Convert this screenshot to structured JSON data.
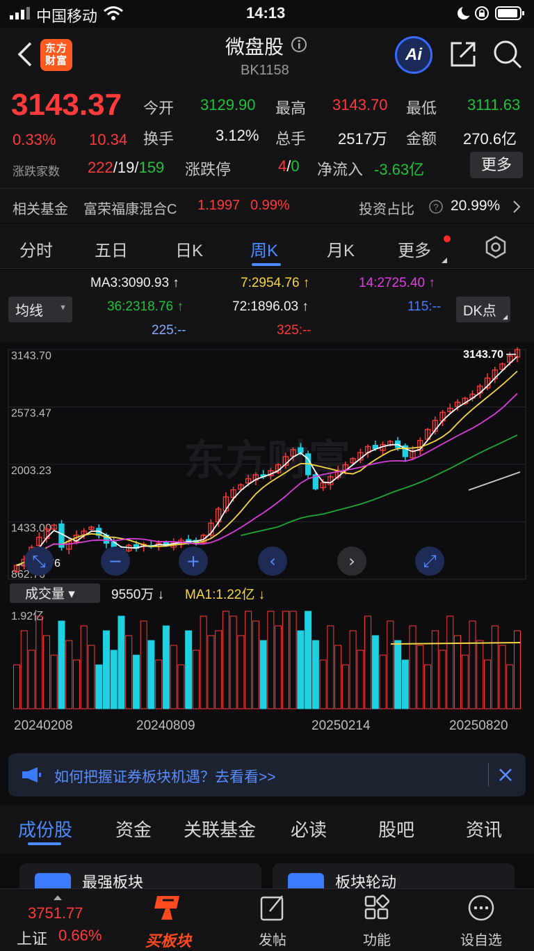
{
  "status_bar": {
    "carrier": "中国移动",
    "time": "14:13"
  },
  "header": {
    "title": "微盘股",
    "code": "BK1158",
    "logo_text": "东方财富",
    "ai_label": "Ai"
  },
  "quote": {
    "price": "3143.37",
    "change_pct": "0.33%",
    "change": "10.34",
    "open_label": "今开",
    "open": "3129.90",
    "high_label": "最高",
    "high": "3143.70",
    "low_label": "最低",
    "low": "3111.63",
    "turnover_label": "换手",
    "turnover": "3.12%",
    "volume_label": "总手",
    "volume": "2517万",
    "amount_label": "金额",
    "amount": "270.6亿",
    "breadth_label": "涨跌家数",
    "up": "222",
    "flat": "19",
    "down": "159",
    "limit_label": "涨跌停",
    "limit_up": "4",
    "limit_down": "0",
    "netflow_label": "净流入",
    "netflow": "-3.63亿",
    "more_button": "更多",
    "fund_label": "相关基金",
    "fund_name": "富荣福康混合C",
    "fund_nav": "1.1997",
    "fund_pct": "0.99%",
    "invest_label": "投资占比",
    "invest_pct": "20.99%"
  },
  "tabs": [
    "分时",
    "五日",
    "日K",
    "周K",
    "月K",
    "更多"
  ],
  "active_tab": "周K",
  "ma": {
    "ma_dropdown": "均线",
    "ma3": "MA3:3090.93",
    "ma7": "7:2954.76",
    "ma14": "14:2725.40",
    "ma36": "36:2318.76",
    "ma72": "72:1896.03",
    "ma115": "115:--",
    "ma225": "225:--",
    "ma325": "325:--",
    "dk_button": "DK点"
  },
  "chart_data": {
    "type": "candlestick",
    "y_ticks": [
      "3143.70",
      "2573.47",
      "2003.23",
      "1433.00",
      "862.76"
    ],
    "ylim": [
      862.76,
      3143.7
    ],
    "high_label": "3143.70",
    "low_label": "862.76",
    "watermark": "东方财富",
    "closes": [
      1000,
      1060,
      1180,
      1280,
      1360,
      1400,
      1180,
      1240,
      1300,
      1340,
      1380,
      1300,
      1220,
      1180,
      1150,
      1200,
      1170,
      1210,
      1190,
      1220,
      1200,
      1230,
      1250,
      1230,
      1240,
      1300,
      1420,
      1560,
      1680,
      1750,
      1800,
      1860,
      1900,
      1880,
      1940,
      2000,
      2080,
      2150,
      2120,
      1900,
      1760,
      1820,
      1880,
      1940,
      2000,
      2060,
      2120,
      2180,
      2160,
      2200,
      2230,
      2170,
      2080,
      2140,
      2240,
      2350,
      2440,
      2520,
      2560,
      2620,
      2660,
      2700,
      2780,
      2860,
      2940,
      3000,
      3080,
      3143
    ],
    "volume_dropdown": "成交量",
    "volume_label": "9550万",
    "vol_ma1": "MA1:1.22亿",
    "vol_max_label": "1.92亿",
    "dates": [
      "20240208",
      "20240809",
      "20250214",
      "20250820"
    ]
  },
  "colors": {
    "up": "#ff3b3b",
    "down": "#1ed0e0",
    "ma3": "#ffffff",
    "ma7": "#f5d645",
    "ma14": "#d83fd8",
    "ma36": "#1fa83a",
    "ma72": "#cccccc"
  },
  "notice": {
    "text": "如何把握证券板块机遇？去看看>>"
  },
  "bottom_tabs": [
    "成份股",
    "资金",
    "关联基金",
    "必读",
    "股吧",
    "资讯"
  ],
  "cards": [
    "最强板块",
    "板块轮动"
  ],
  "nav": {
    "index_value": "3751.77",
    "index_name": "上证",
    "index_pct": "0.66%",
    "buy_label": "买板块",
    "post_label": "发帖",
    "func_label": "功能",
    "watch_label": "设自选"
  }
}
